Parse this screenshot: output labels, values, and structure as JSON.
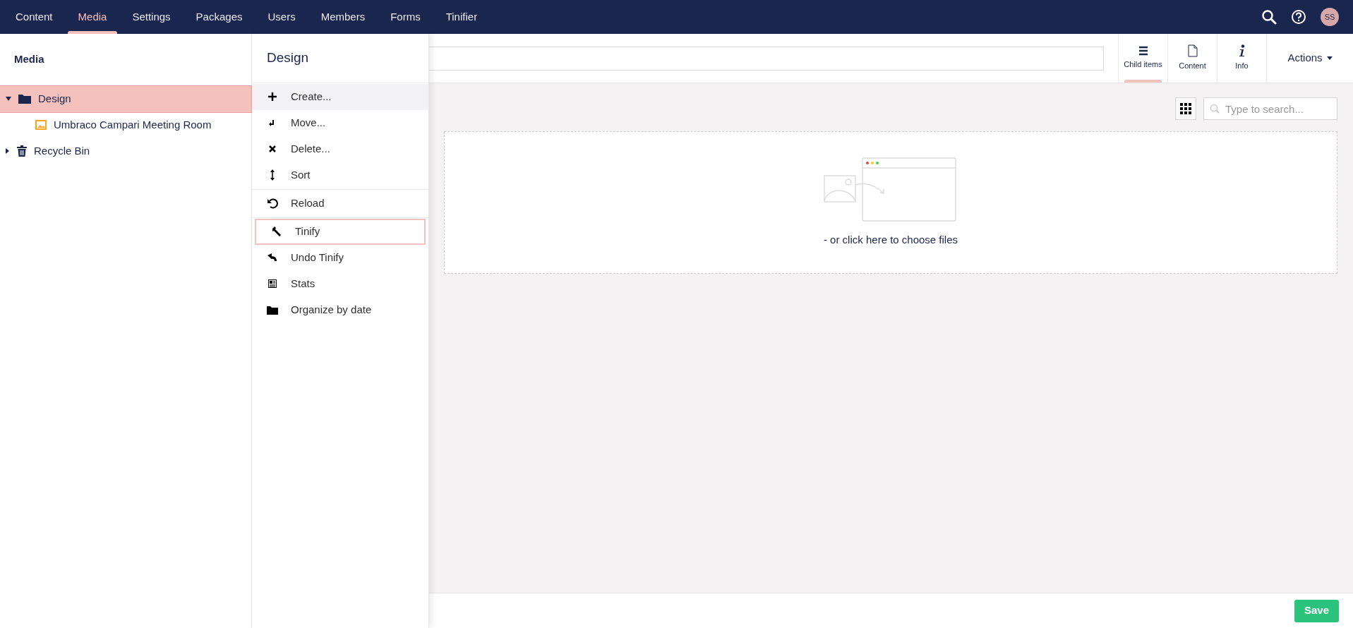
{
  "nav": {
    "sections": [
      {
        "label": "Content",
        "selected": false
      },
      {
        "label": "Media",
        "selected": true
      },
      {
        "label": "Settings",
        "selected": false
      },
      {
        "label": "Packages",
        "selected": false
      },
      {
        "label": "Users",
        "selected": false
      },
      {
        "label": "Members",
        "selected": false
      },
      {
        "label": "Forms",
        "selected": false
      },
      {
        "label": "Tinifier",
        "selected": false
      }
    ],
    "avatar": "SS"
  },
  "tree": {
    "title": "Media",
    "items": [
      {
        "label": "Design",
        "kind": "folder",
        "selected": true,
        "expanded": true,
        "children": [
          {
            "label": "Umbraco Campari Meeting Room",
            "kind": "image",
            "selected": false
          }
        ]
      },
      {
        "label": "Recycle Bin",
        "kind": "bin",
        "selected": false,
        "expanded": false
      }
    ]
  },
  "menu": {
    "title": "Design",
    "groups": [
      [
        {
          "label": "Create...",
          "kind": "plus",
          "hovered": true,
          "focused": false
        },
        {
          "label": "Move...",
          "kind": "move",
          "hovered": false,
          "focused": false
        },
        {
          "label": "Delete...",
          "kind": "delete",
          "hovered": false,
          "focused": false
        },
        {
          "label": "Sort",
          "kind": "sort",
          "hovered": false,
          "focused": false
        }
      ],
      [
        {
          "label": "Reload",
          "kind": "reload",
          "hovered": false,
          "focused": false
        }
      ],
      [
        {
          "label": "Tinify",
          "kind": "wrench",
          "hovered": false,
          "focused": true
        },
        {
          "label": "Undo Tinify",
          "kind": "undo",
          "hovered": false,
          "focused": false
        },
        {
          "label": "Stats",
          "kind": "stats",
          "hovered": false,
          "focused": false
        },
        {
          "label": "Organize by date",
          "kind": "folder",
          "hovered": false,
          "focused": false
        }
      ]
    ]
  },
  "apps": [
    {
      "label": "Child items",
      "kind": "list",
      "selected": true
    },
    {
      "label": "Content",
      "kind": "doc",
      "selected": false
    },
    {
      "label": "Info",
      "kind": "info",
      "selected": false
    }
  ],
  "actions": "Actions",
  "search": {
    "placeholder": "Type to search..."
  },
  "dropzone": {
    "text": "- or click here to choose files"
  },
  "save": "Save"
}
